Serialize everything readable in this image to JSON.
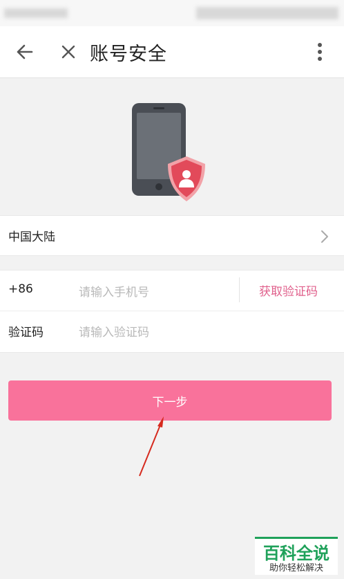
{
  "header": {
    "title": "账号安全"
  },
  "region": {
    "label": "中国大陆"
  },
  "phone": {
    "country_code": "+86",
    "placeholder": "请输入手机号",
    "get_code_label": "获取验证码"
  },
  "verify": {
    "label": "验证码",
    "placeholder": "请输入验证码"
  },
  "actions": {
    "next_label": "下一步"
  },
  "watermark": {
    "title": "百科全说",
    "subtitle": "助你轻松解决"
  },
  "colors": {
    "accent_pink": "#f9729b",
    "link_pink": "#e0608c",
    "shield_red": "#e24a5a",
    "watermark_green": "#1fa15a",
    "arrow_red": "#d62a1e"
  }
}
